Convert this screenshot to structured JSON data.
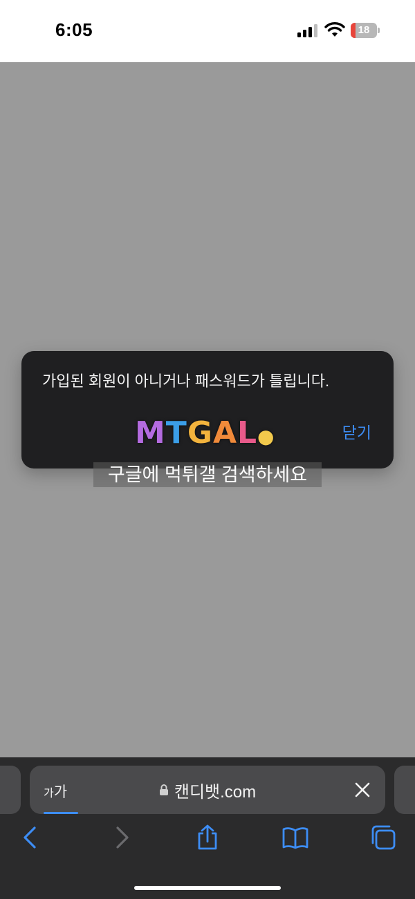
{
  "status_bar": {
    "time": "6:05",
    "battery_level": "18",
    "battery_color": "#e8443a"
  },
  "alert": {
    "message": "가입된 회원이 아니거나 패스워드가 틀립니다.",
    "close_label": "닫기",
    "accent_color": "#3d8df5"
  },
  "logo": {
    "text": "MTGAL"
  },
  "banner": {
    "text": "구글에 먹튀갤 검색하세요"
  },
  "browser": {
    "aa_small": "가",
    "aa_large": "가",
    "url": "캔디뱃.com",
    "icons": [
      "lock-icon",
      "close-icon",
      "back-icon",
      "forward-icon",
      "share-icon",
      "bookmarks-icon",
      "tabs-icon"
    ]
  }
}
